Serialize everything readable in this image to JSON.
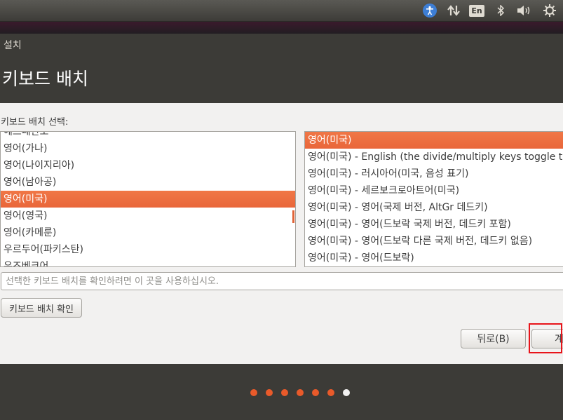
{
  "panel": {
    "keyboard_indicator": "En",
    "icons": [
      "accessibility-icon",
      "network-icon",
      "keyboard-indicator",
      "bluetooth-icon",
      "sound-icon",
      "gear-icon"
    ]
  },
  "window": {
    "title": "설치"
  },
  "page": {
    "heading": "키보드 배치"
  },
  "layout_selector": {
    "prompt": "키보드 배치 선택:",
    "layouts": [
      {
        "label": "에스페란토",
        "selected": false
      },
      {
        "label": "영어(가나)",
        "selected": false
      },
      {
        "label": "영어(나이지리아)",
        "selected": false
      },
      {
        "label": "영어(남아공)",
        "selected": false
      },
      {
        "label": "영어(미국)",
        "selected": true
      },
      {
        "label": "영어(영국)",
        "selected": false
      },
      {
        "label": "영어(카메룬)",
        "selected": false
      },
      {
        "label": "우르두어(파키스탄)",
        "selected": false
      },
      {
        "label": "우즈베크어",
        "selected": false
      }
    ],
    "variants": [
      {
        "label": "영어(미국)",
        "selected": true
      },
      {
        "label": "영어(미국) - English (the divide/multiply keys toggle the layout)",
        "selected": false
      },
      {
        "label": "영어(미국) - 러시아어(미국, 음성 표기)",
        "selected": false
      },
      {
        "label": "영어(미국) - 세르보크로아트어(미국)",
        "selected": false
      },
      {
        "label": "영어(미국) - 영어(국제 버전, AltGr 데드키)",
        "selected": false
      },
      {
        "label": "영어(미국) - 영어(드보락 국제 버전, 데드키 포함)",
        "selected": false
      },
      {
        "label": "영어(미국) - 영어(드보락 다른 국제 버전, 데드키 없음)",
        "selected": false
      },
      {
        "label": "영어(미국) - 영어(드보락)",
        "selected": false
      }
    ]
  },
  "test_field": {
    "placeholder": "선택한 키보드 배치를 확인하려면 이 곳을 사용하십시오.",
    "value": ""
  },
  "buttons": {
    "detect": "키보드 배치 확인",
    "back": "뒤로(B)",
    "continue": "계속"
  },
  "progress": {
    "total_steps": 7,
    "current_step": 7
  },
  "colors": {
    "accent": "#e95a2a",
    "highlight_box": "#e8141a",
    "selection": "#f07746"
  }
}
